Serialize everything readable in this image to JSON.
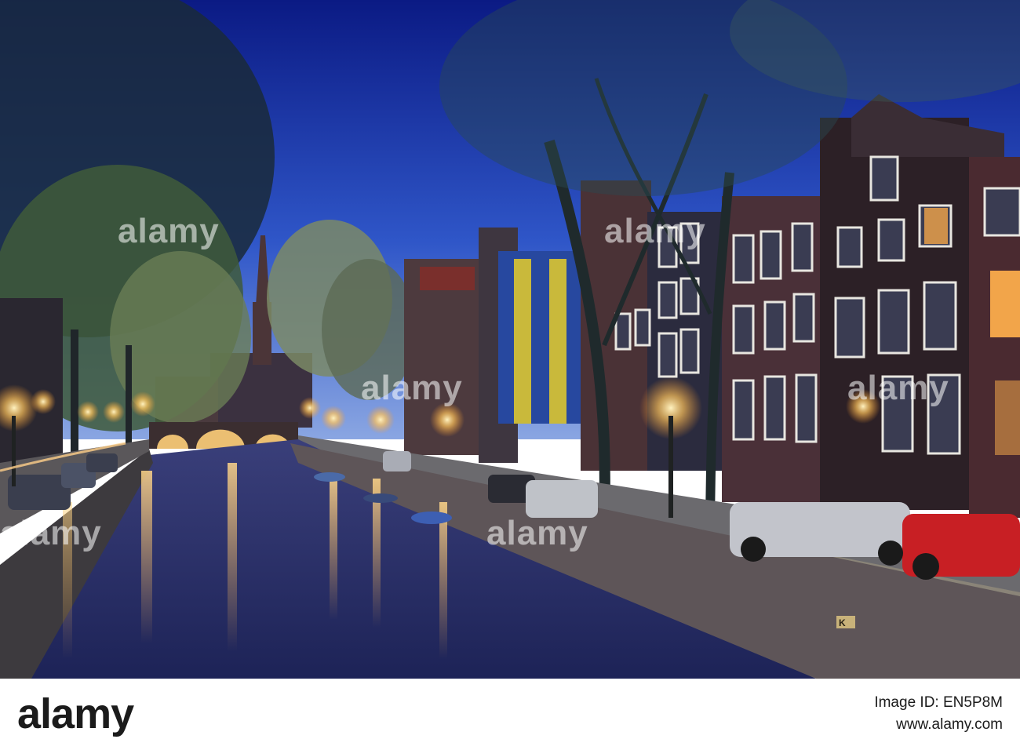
{
  "photo": {
    "caption_sign": "K"
  },
  "watermark": {
    "text": "alamy"
  },
  "footer": {
    "brand": "alamy",
    "image_id": "Image ID: EN5P8M",
    "site": "www.alamy.com"
  },
  "colors": {
    "sky_top": "#0d1f8f",
    "sky_bottom": "#6f8fd6",
    "water": "#28306a",
    "lamp_glow": "#ffd27a"
  }
}
